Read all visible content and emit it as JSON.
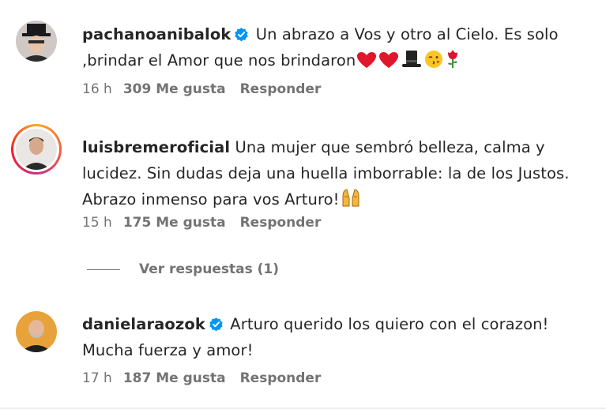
{
  "comments": [
    {
      "username": "pachanoanibalok",
      "verified": true,
      "text_line1": "Un abrazo a Vos y otro al Cielo. Es solo",
      "text_line2": ",brindar el Amor que nos brindaron",
      "emojis": [
        "heart-icon",
        "heart-icon",
        "top-hat-icon",
        "kissing-face-icon",
        "rose-icon"
      ],
      "time": "16 h",
      "likes": "309 Me gusta",
      "reply": "Responder"
    },
    {
      "username": "luisbremeroficial",
      "verified": false,
      "text_line1": "Una mujer que sembró belleza, calma y",
      "text_line2": "lucidez. Sin dudas deja una huella imborrable: la de los Justos.",
      "text_line3": "Abrazo inmenso para vos Arturo!",
      "emojis": [
        "raising-hands-icon"
      ],
      "time": "15 h",
      "likes": "175 Me gusta",
      "reply": "Responder",
      "view_replies": "Ver respuestas (1)"
    },
    {
      "username": "danielaraozok",
      "verified": true,
      "text_line1": "Arturo querido los quiero con el corazon!",
      "text_line2": "Mucha fuerza y amor!",
      "time": "17 h",
      "likes": "187 Me gusta",
      "reply": "Responder"
    }
  ],
  "colors": {
    "text": "#262626",
    "meta": "#737373",
    "verified": "#0095f6"
  }
}
